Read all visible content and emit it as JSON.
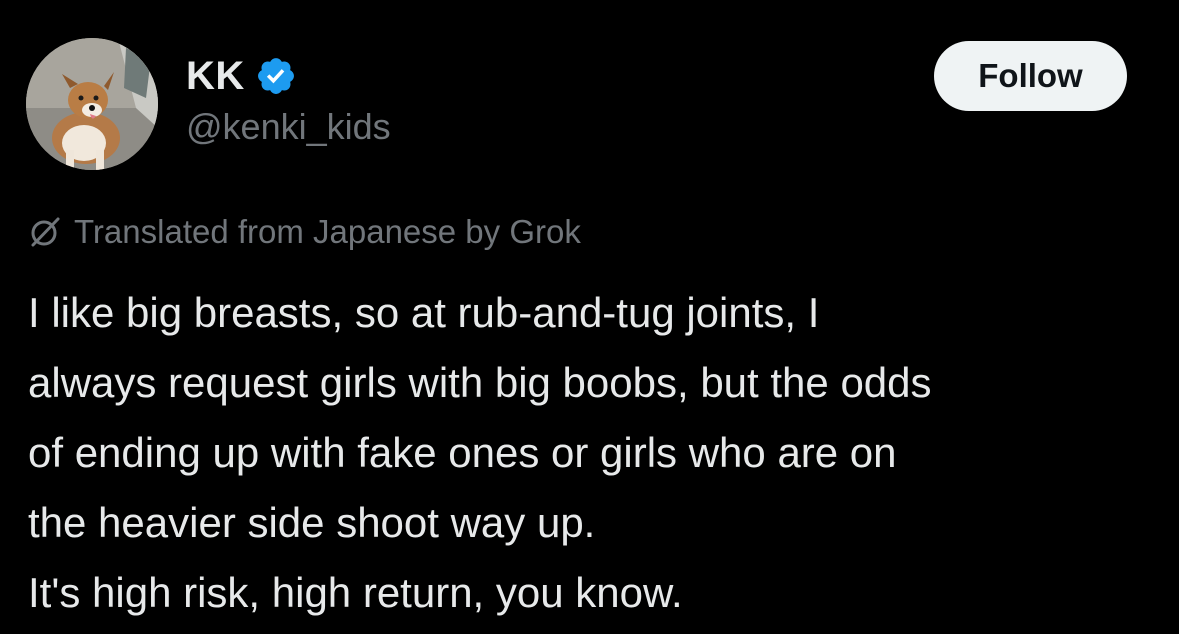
{
  "author": {
    "display_name": "KK",
    "handle": "@kenki_kids",
    "verified": true,
    "avatar_icon": "dog-photo-avatar",
    "verified_icon": "verified-badge-icon",
    "verified_color": "#1d9bf0"
  },
  "follow_button": {
    "label": "Follow"
  },
  "translation": {
    "icon": "grok-icon",
    "label": "Translated from Japanese by Grok"
  },
  "post": {
    "lines": [
      "I like big breasts, so at rub-and-tug joints, I",
      "always request girls with big boobs, but the odds",
      "of ending up with fake ones or girls who are on",
      "the heavier side shoot way up.",
      "It's high risk, high return, you know."
    ]
  },
  "colors": {
    "background": "#000000",
    "primary_text": "#e7e9ea",
    "secondary_text": "#71767b",
    "follow_button_bg": "#eff3f4",
    "follow_button_text": "#0f1419"
  }
}
